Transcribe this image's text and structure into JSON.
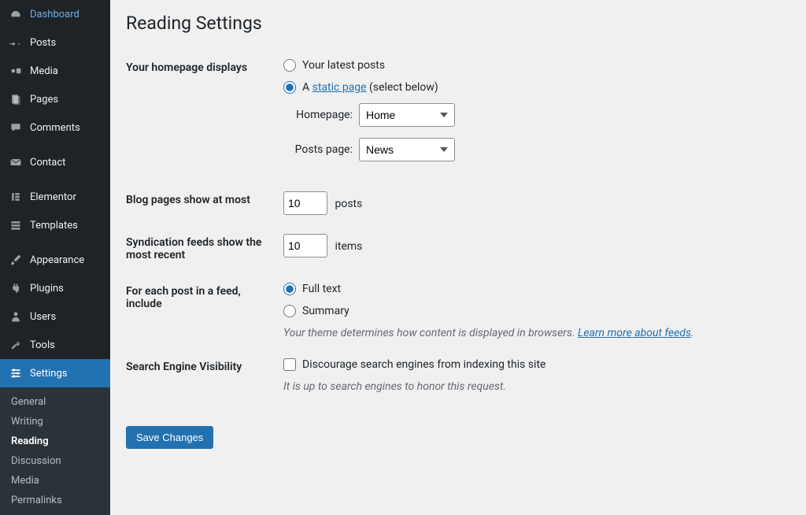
{
  "sidebar": {
    "items": [
      {
        "label": "Dashboard",
        "icon": "dashboard"
      },
      {
        "label": "Posts",
        "icon": "pin"
      },
      {
        "label": "Media",
        "icon": "media"
      },
      {
        "label": "Pages",
        "icon": "pages"
      },
      {
        "label": "Comments",
        "icon": "comments"
      },
      {
        "label": "Contact",
        "icon": "mail"
      },
      {
        "label": "Elementor",
        "icon": "elementor"
      },
      {
        "label": "Templates",
        "icon": "templates"
      },
      {
        "label": "Appearance",
        "icon": "brush"
      },
      {
        "label": "Plugins",
        "icon": "plug"
      },
      {
        "label": "Users",
        "icon": "user"
      },
      {
        "label": "Tools",
        "icon": "wrench"
      },
      {
        "label": "Settings",
        "icon": "sliders"
      }
    ],
    "current": 12,
    "submenu": [
      {
        "label": "General"
      },
      {
        "label": "Writing"
      },
      {
        "label": "Reading",
        "current": true
      },
      {
        "label": "Discussion"
      },
      {
        "label": "Media"
      },
      {
        "label": "Permalinks"
      }
    ]
  },
  "page": {
    "title": "Reading Settings",
    "rows": {
      "homepage_label": "Your homepage displays",
      "radio_latest": "Your latest posts",
      "radio_static_prefix": "A ",
      "radio_static_link": "static page",
      "radio_static_suffix": " (select below)",
      "homepage_field_label": "Homepage:",
      "homepage_value": "Home",
      "posts_page_label": "Posts page:",
      "posts_page_value": "News",
      "blog_pages_label": "Blog pages show at most",
      "blog_pages_value": "10",
      "blog_pages_unit": "posts",
      "syndication_label": "Syndication feeds show the most recent",
      "syndication_value": "10",
      "syndication_unit": "items",
      "feed_include_label": "For each post in a feed, include",
      "feed_full": "Full text",
      "feed_summary": "Summary",
      "feed_desc_prefix": "Your theme determines how content is displayed in browsers. ",
      "feed_desc_link": "Learn more about feeds",
      "feed_desc_suffix": ".",
      "search_vis_label": "Search Engine Visibility",
      "search_checkbox": "Discourage search engines from indexing this site",
      "search_desc": "It is up to search engines to honor this request.",
      "save": "Save Changes"
    }
  }
}
